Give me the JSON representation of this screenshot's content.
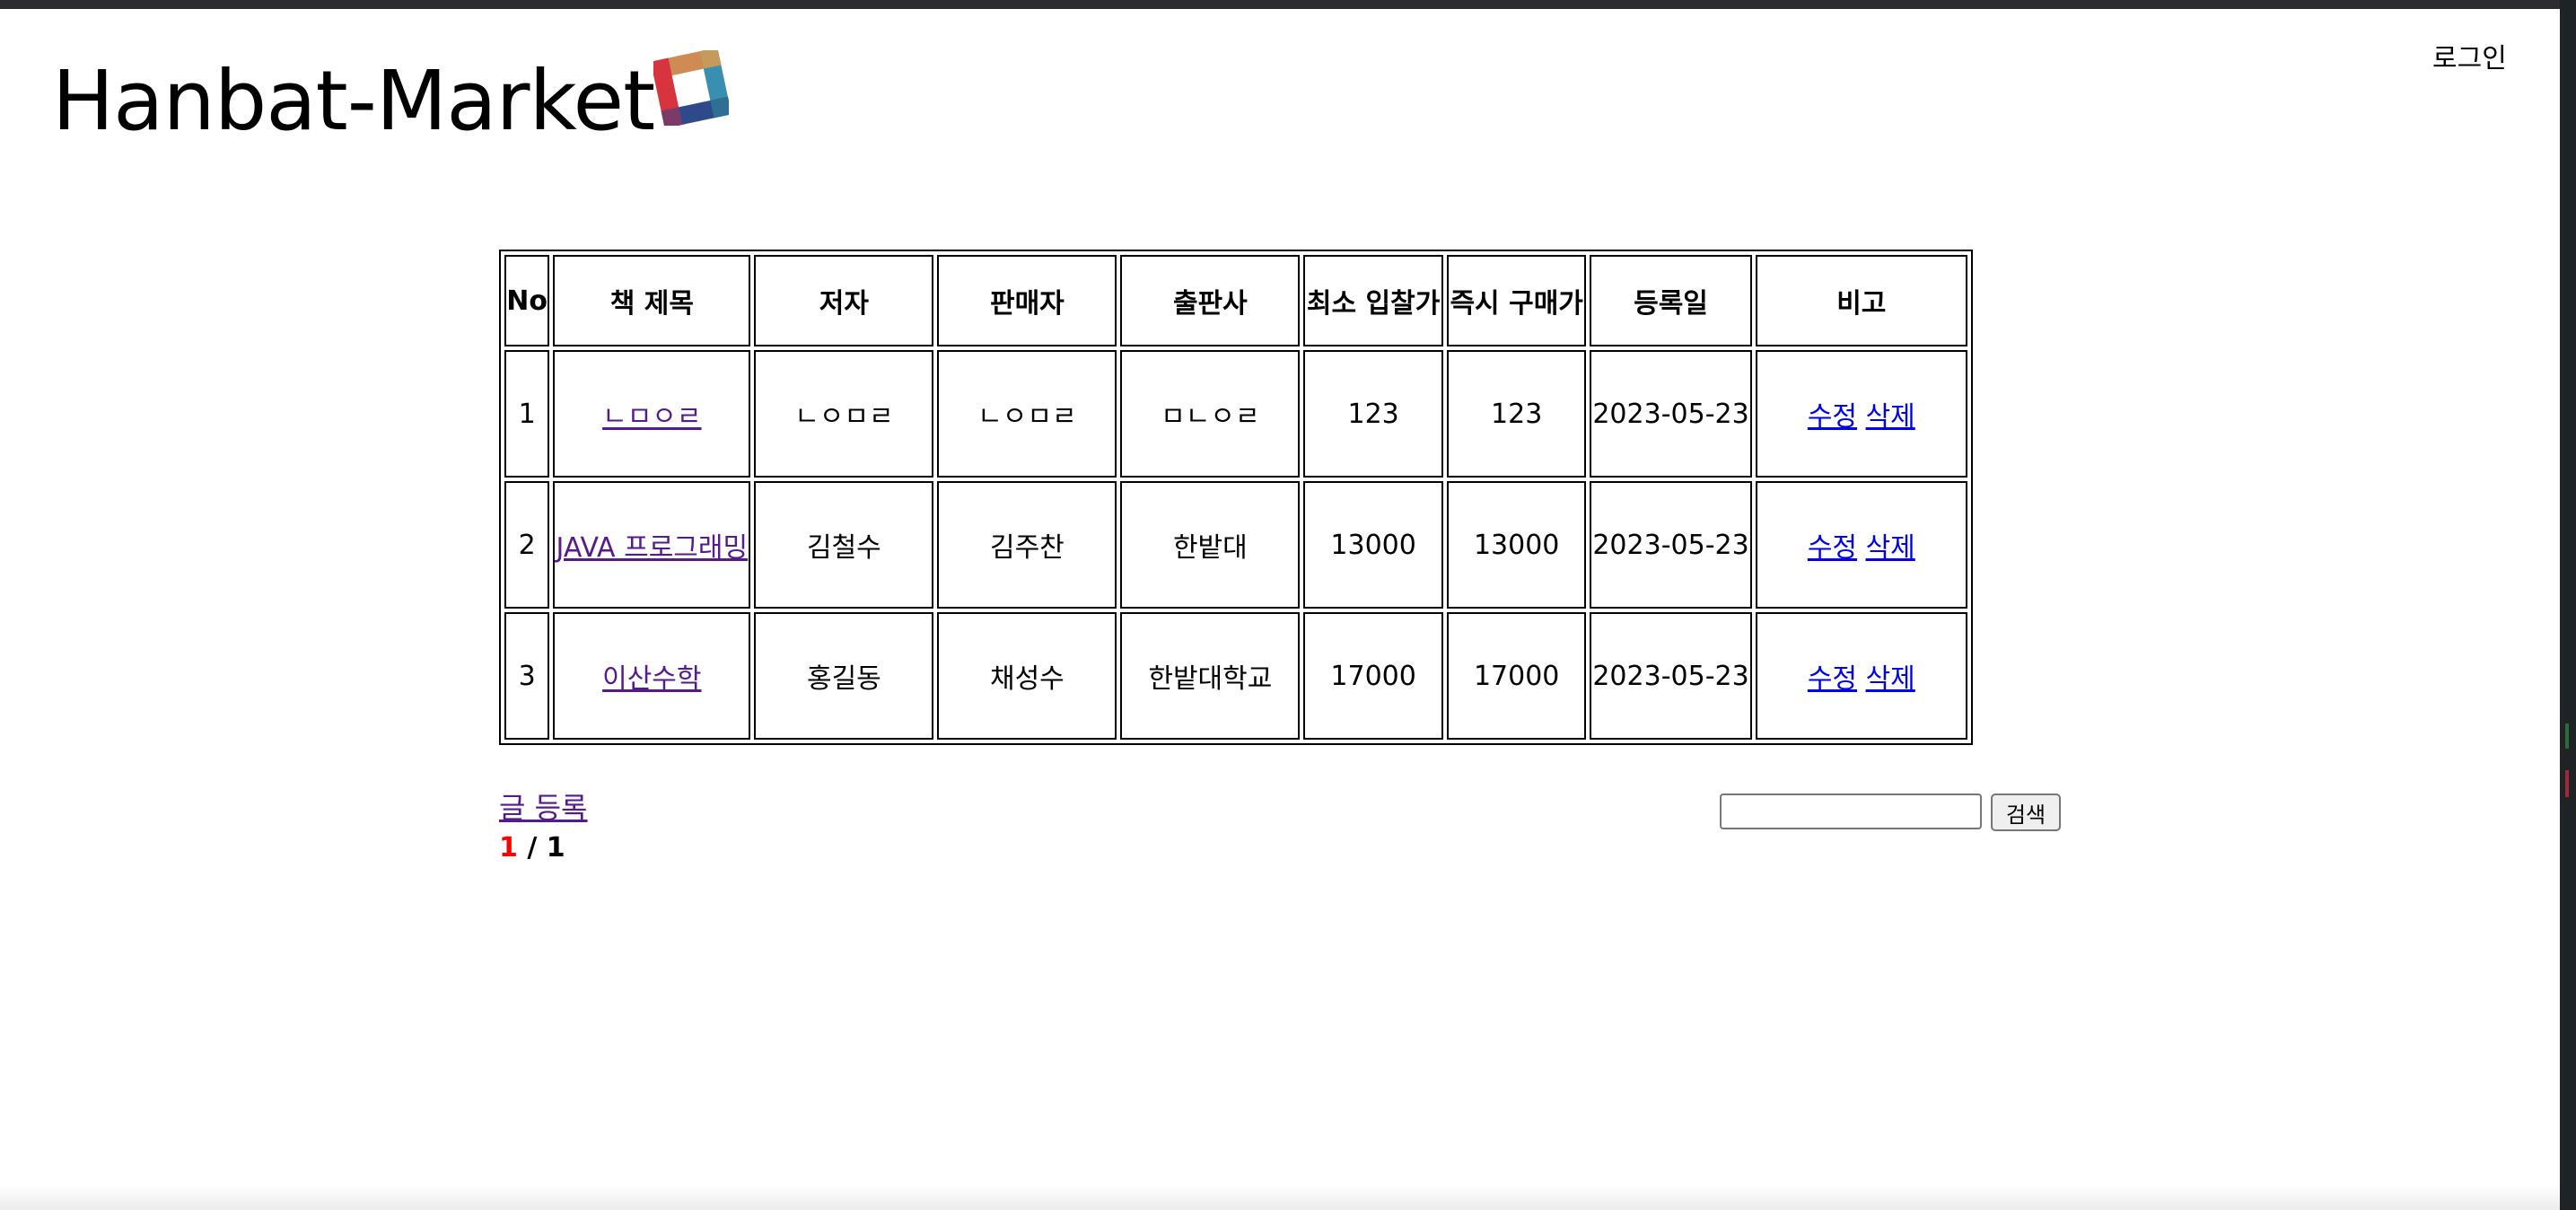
{
  "header": {
    "site_title": "Hanbat-Market",
    "login_label": "로그인"
  },
  "table": {
    "columns": [
      "No",
      "책 제목",
      "저자",
      "판매자",
      "출판사",
      "최소 입찰가",
      "즉시 구매가",
      "등록일",
      "비고"
    ],
    "rows": [
      {
        "no": "1",
        "title": "ㄴㅁㅇㄹ",
        "author": "ㄴㅇㅁㄹ",
        "seller": "ㄴㅇㅁㄹ",
        "publisher": "ㅁㄴㅇㄹ",
        "min_bid": "123",
        "buy_now": "123",
        "date": "2023-05-23",
        "edit": "수정",
        "delete": "삭제"
      },
      {
        "no": "2",
        "title": "JAVA 프로그래밍",
        "author": "김철수",
        "seller": "김주찬",
        "publisher": "한밭대",
        "min_bid": "13000",
        "buy_now": "13000",
        "date": "2023-05-23",
        "edit": "수정",
        "delete": "삭제"
      },
      {
        "no": "3",
        "title": "이산수학",
        "author": "홍길동",
        "seller": "채성수",
        "publisher": "한밭대학교",
        "min_bid": "17000",
        "buy_now": "17000",
        "date": "2023-05-23",
        "edit": "수정",
        "delete": "삭제"
      }
    ]
  },
  "footer": {
    "write_label": "글 등록",
    "page_current": "1",
    "page_separator": " / ",
    "page_total": "1"
  },
  "search": {
    "value": "",
    "button_label": "검색"
  },
  "colors": {
    "visited_link": "#551a8b",
    "action_link": "#0000ee",
    "current_page": "#ff0000"
  },
  "logo": {
    "icon": "square-ring-logo-icon"
  }
}
